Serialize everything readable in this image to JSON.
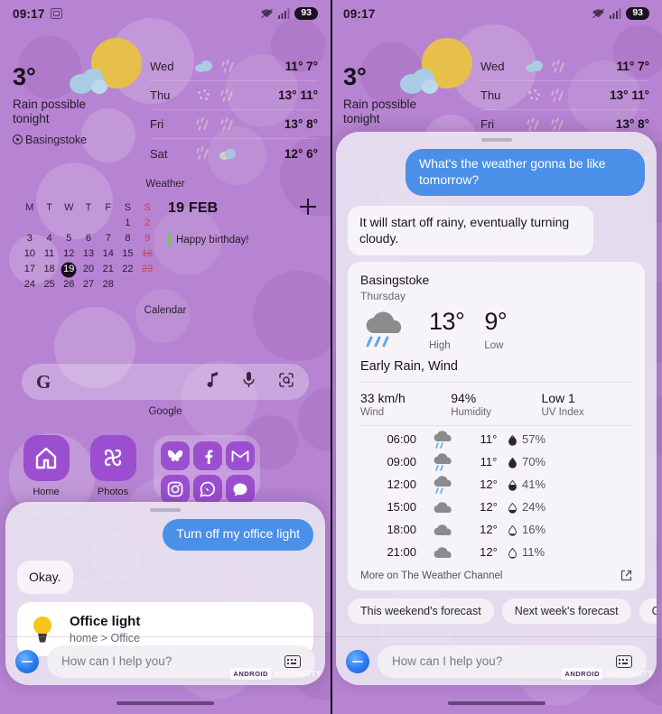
{
  "status_bar": {
    "time": "09:17",
    "battery": "93",
    "screenshot_icon": "screenshot-icon",
    "wifi_icon": "wifi-icon",
    "signal_icon": "cellular-signal-icon"
  },
  "weather_widget": {
    "temperature": "3°",
    "description": "Rain possible tonight",
    "location": "Basingstoke",
    "widget_label": "Weather",
    "forecast": [
      {
        "day": "Wed",
        "icons": [
          "cloud",
          "rain"
        ],
        "high": "11°",
        "low": "7°"
      },
      {
        "day": "Thu",
        "icons": [
          "snow",
          "rain"
        ],
        "high": "13°",
        "low": "11°"
      },
      {
        "day": "Fri",
        "icons": [
          "rain",
          "rain"
        ],
        "high": "13°",
        "low": "8°"
      },
      {
        "day": "Sat",
        "icons": [
          "rain",
          "sleet"
        ],
        "high": "12°",
        "low": "6°"
      }
    ]
  },
  "calendar_widget": {
    "widget_label": "Calendar",
    "date_header": "19 FEB",
    "add_icon": "plus-icon",
    "weekday_headers": [
      "M",
      "T",
      "W",
      "T",
      "F",
      "S",
      "S"
    ],
    "weeks": [
      [
        "",
        "",
        "",
        "",
        "",
        "1",
        "2"
      ],
      [
        "3",
        "4",
        "5",
        "6",
        "7",
        "8",
        "9"
      ],
      [
        "10",
        "11",
        "12",
        "13",
        "14",
        "15",
        "16"
      ],
      [
        "17",
        "18",
        "19",
        "20",
        "21",
        "22",
        "23"
      ],
      [
        "24",
        "25",
        "26",
        "27",
        "28",
        "",
        ""
      ]
    ],
    "today": "19",
    "strikethrough_days": [
      "16",
      "23"
    ],
    "event": {
      "title": "Happy birthday!",
      "color": "#7bbf6a"
    }
  },
  "google_search": {
    "widget_label": "Google",
    "logo": "google-g-logo",
    "music_icon": "music-note-icon",
    "mic_icon": "microphone-icon",
    "lens_icon": "google-lens-icon"
  },
  "apps": {
    "home": {
      "label": "Home",
      "icon": "google-home-icon"
    },
    "photos": {
      "label": "Photos",
      "icon": "google-photos-icon"
    },
    "folder_icons": [
      "bluesky-butterfly-icon",
      "facebook-icon",
      "gmail-icon",
      "instagram-icon",
      "whatsapp-icon",
      "messages-icon"
    ]
  },
  "left_assistant": {
    "user_message": "Turn off my office light",
    "bot_message": "Okay.",
    "device_card": {
      "name": "Office light",
      "path": "home > Office",
      "icon": "light-bulb-icon"
    },
    "input": {
      "placeholder": "How can I help you?",
      "keyboard_icon": "keyboard-icon",
      "assistant_icon": "assistant-orb-icon"
    }
  },
  "right_assistant": {
    "user_message": "What's the weather gonna be like tomorrow?",
    "bot_message": "It will start off rainy, eventually turning cloudy.",
    "weather_result": {
      "city": "Basingstoke",
      "day": "Thursday",
      "icon": "rain-cloud-icon",
      "high_temp": "13°",
      "high_label": "High",
      "low_temp": "9°",
      "low_label": "Low",
      "condition": "Early Rain, Wind",
      "stats": [
        {
          "value": "33 km/h",
          "label": "Wind"
        },
        {
          "value": "94%",
          "label": "Humidity"
        },
        {
          "value": "Low 1",
          "label": "UV Index"
        }
      ],
      "hourly": [
        {
          "time": "06:00",
          "icon": "rain-cloud",
          "temp": "11°",
          "precip": "57%"
        },
        {
          "time": "09:00",
          "icon": "rain-cloud",
          "temp": "11°",
          "precip": "70%"
        },
        {
          "time": "12:00",
          "icon": "rain-cloud",
          "temp": "12°",
          "precip": "41%"
        },
        {
          "time": "15:00",
          "icon": "cloud",
          "temp": "12°",
          "precip": "24%"
        },
        {
          "time": "18:00",
          "icon": "cloud",
          "temp": "12°",
          "precip": "16%"
        },
        {
          "time": "21:00",
          "icon": "cloud",
          "temp": "12°",
          "precip": "11%"
        }
      ],
      "more_link": "More on The Weather Channel",
      "external_icon": "external-link-icon"
    },
    "chips": [
      "This weekend's forecast",
      "Next week's forecast",
      "Conv"
    ],
    "input": {
      "placeholder": "How can I help you?",
      "keyboard_icon": "keyboard-icon",
      "assistant_icon": "assistant-orb-icon"
    }
  },
  "watermark": {
    "brand": "ANDROID",
    "suffix": "AUTHORITY"
  },
  "colors": {
    "wallpaper": "#b684d2",
    "user_bubble": "#4a90e8",
    "accent_event": "#7bbf6a",
    "sun": "#e6c04a",
    "cloud": "#a9cbe3"
  }
}
